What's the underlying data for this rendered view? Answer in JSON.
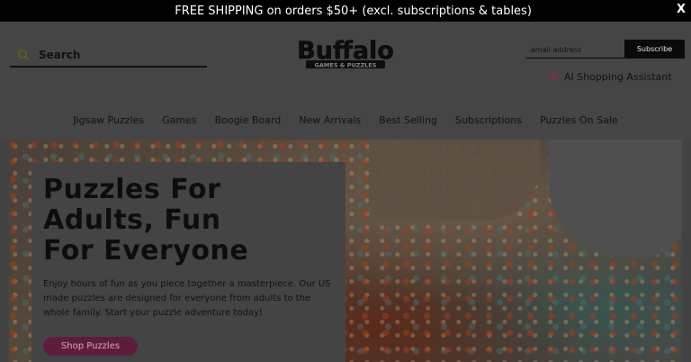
{
  "announcement": {
    "text": "  FREE SHIPPING on orders $50+ (excl. subscriptions & tables)",
    "close_label": "X"
  },
  "header": {
    "search": {
      "placeholder": "Search",
      "icon": "search-icon"
    },
    "logo": {
      "main": "Buffalo",
      "sub": "GAMES & PUZZLES"
    },
    "newsletter": {
      "placeholder": "email address",
      "button_label": "Subscribe"
    },
    "ai_assistant": {
      "label": "AI Shopping Assistant",
      "icon": "sparkle-icon",
      "icon_color": "#b0306a"
    }
  },
  "nav": {
    "items": [
      "Jigsaw Puzzles",
      "Games",
      "Boogie Board",
      "New Arrivals",
      "Best Selling",
      "Subscriptions",
      "Puzzles On Sale"
    ]
  },
  "hero": {
    "title_lines": [
      "Puzzles For",
      "Adults, Fun",
      "For Everyone"
    ],
    "description": "Enjoy hours of fun as you piece together a masterpiece. Our US made puzzles are designed for everyone from adults to the whole family. Start your puzzle adventure today!",
    "cta_label": "Shop Puzzles",
    "cta_color": "#5e1d3d"
  }
}
